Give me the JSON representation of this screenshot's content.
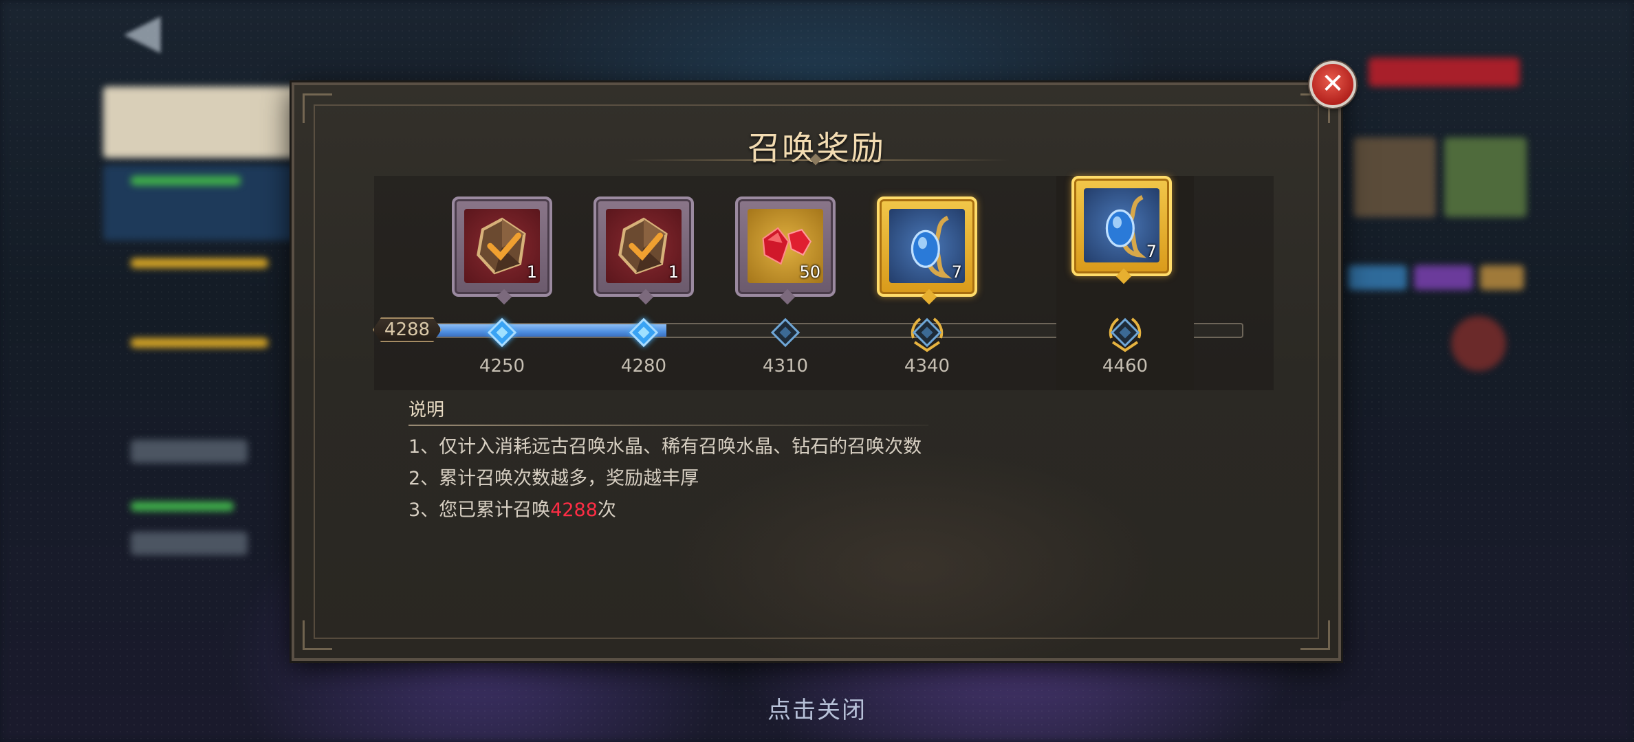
{
  "popup": {
    "title": "召唤奖励",
    "current_count": "4288",
    "progress_fraction": 0.3
  },
  "rewards": [
    {
      "threshold": "4250",
      "icon": "summon-crystal-icon",
      "count": "1",
      "rarity": "purple",
      "reached": true
    },
    {
      "threshold": "4280",
      "icon": "summon-crystal-icon",
      "count": "1",
      "rarity": "purple",
      "reached": true
    },
    {
      "threshold": "4310",
      "icon": "ruby-gems-icon",
      "count": "50",
      "rarity": "purple",
      "reached": false
    },
    {
      "threshold": "4340",
      "icon": "blue-sapphire-icon",
      "count": "7",
      "rarity": "gold",
      "reached": false
    }
  ],
  "final_reward": {
    "threshold": "4460",
    "icon": "blue-sapphire-icon",
    "count": "7",
    "rarity": "gold"
  },
  "description": {
    "title": "说明",
    "items": [
      "1、仅计入消耗远古召唤水晶、稀有召唤水晶、钻石的召唤次数",
      "2、累计召唤次数越多，奖励越丰厚"
    ],
    "item3_prefix": "3、您已累计召唤",
    "item3_value": "4288",
    "item3_suffix": "次"
  },
  "footer": {
    "close_hint": "点击关闭"
  },
  "colors": {
    "highlight": "#ff2d45",
    "progress": "#4f8fe0",
    "title": "#f3dcb2"
  }
}
